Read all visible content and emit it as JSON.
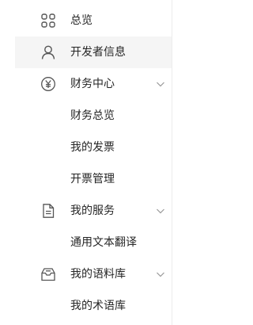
{
  "sidebar": {
    "items": [
      {
        "label": "总览",
        "icon": "grid-icon"
      },
      {
        "label": "开发者信息",
        "icon": "user-icon",
        "active": true
      },
      {
        "label": "财务中心",
        "icon": "yen-circle-icon",
        "expandable": true
      },
      {
        "label": "财务总览"
      },
      {
        "label": "我的发票"
      },
      {
        "label": "开票管理"
      },
      {
        "label": "我的服务",
        "icon": "document-icon",
        "expandable": true
      },
      {
        "label": "通用文本翻译"
      },
      {
        "label": "我的语料库",
        "icon": "inbox-icon",
        "expandable": true
      },
      {
        "label": "我的术语库"
      }
    ]
  },
  "colors": {
    "text": "#262626",
    "icon": "#555555",
    "active_bg": "#f5f5f5",
    "divider": "#ececec"
  }
}
